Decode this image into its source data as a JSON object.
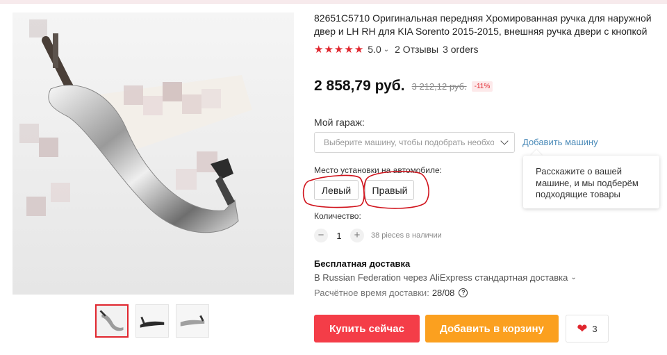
{
  "product": {
    "title": "82651C5710 Оригинальная передняя Хромированная ручка для наружной двер и LH RH для KIA Sorento 2015-2015, внешняя ручка двери с кнопкой",
    "stars": [
      "★",
      "★",
      "★",
      "★",
      "★"
    ],
    "rating": "5.0",
    "reviews": "2 Отзывы",
    "orders": "3 orders",
    "price": "2 858,79 руб.",
    "old_price": "3 212,12 руб.",
    "discount": "-11%"
  },
  "garage": {
    "label": "Мой гараж:",
    "placeholder": "Выберите машину, чтобы подобрать необход",
    "add_link": "Добавить машину",
    "tooltip": "Расскажите о вашей машине, и мы подберём подходящие товары"
  },
  "install": {
    "label": "Место установки на автомобиле:",
    "options": [
      "Левый",
      "Правый"
    ]
  },
  "quantity": {
    "label": "Количество:",
    "minus": "−",
    "plus": "+",
    "value": "1",
    "stock": "38 pieces в наличии"
  },
  "shipping": {
    "title": "Бесплатная доставка",
    "route": "В Russian Federation через AliExpress стандартная доставка",
    "time_label": "Расчётное время доставки:",
    "time_value": "28/08",
    "help": "?"
  },
  "actions": {
    "buy_now": "Купить сейчас",
    "add_to_cart": "Добавить в корзину",
    "wishlist_count": "3"
  },
  "icons": {
    "rating_caret": "chevron-down-icon",
    "heart": "heart-icon",
    "help": "question-circle-icon"
  },
  "colors": {
    "accent_red": "#f43d48",
    "cart_orange": "#fba01f",
    "star_red": "#e0262e",
    "link_blue": "#4a8ab8",
    "marker_red": "#d0121b"
  }
}
